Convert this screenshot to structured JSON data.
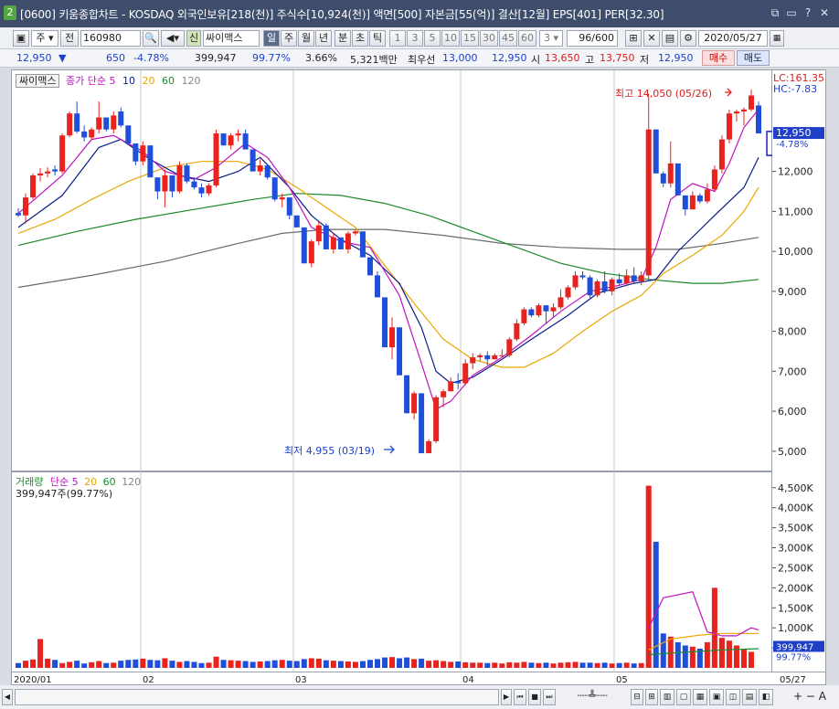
{
  "window": {
    "number": "2",
    "title": "[0600] 키움종합차트 - KOSDAQ 외국인보유[218(천)] 주식수[10,924(천)] 액면[500] 자본금[55(억)] 결산[12월] EPS[401] PER[32.30]",
    "buttons": [
      "⧉",
      "▭",
      "?",
      "✕"
    ]
  },
  "toolbar": {
    "period_select": "주",
    "prev_label": "전",
    "code": "160980",
    "new_badge": "신",
    "stock_name": "싸이맥스",
    "period_tabs": [
      "일",
      "주",
      "월",
      "년",
      "분",
      "초",
      "틱"
    ],
    "minute_options": [
      "1",
      "3",
      "5",
      "10",
      "15",
      "30",
      "45",
      "60"
    ],
    "minute_value": "3",
    "count": "96/600",
    "date": "2020/05/27"
  },
  "quote": {
    "price": "12,950",
    "change_arrow": "▼",
    "change": "650",
    "change_pct": "-4.78%",
    "volume": "399,947",
    "vol_ratio": "99.77%",
    "turnover": "3.66%",
    "amount": "5,321백만",
    "best_ask_label": "최우선",
    "best_ask": "13,000",
    "best_bid": "12,950",
    "open_label": "시",
    "open": "13,650",
    "high_label": "고",
    "high": "13,750",
    "low_label": "저",
    "low": "12,950",
    "buy_label": "매수",
    "sell_label": "매도"
  },
  "legend": {
    "name": "싸이맥스",
    "ma_label": "종가 단순",
    "ma_periods": [
      "5",
      "10",
      "20",
      "60",
      "120"
    ]
  },
  "vol_legend": {
    "name": "거래량",
    "ma_label": "단순",
    "ma_periods": [
      "5",
      "20",
      "60",
      "120"
    ],
    "current": "399,947주(99.77%)"
  },
  "annotations": {
    "high": "최고 14,050 (05/26)",
    "low": "최저 4,955 (03/19)",
    "lc": "LC:161.35",
    "hc": "HC:-7.83",
    "last_price": "12,950",
    "last_pct": "-4.78%",
    "last_vol": "399,947",
    "last_vol_pct": "99.77%"
  },
  "colors": {
    "up": "#e8231f",
    "down": "#1f4ed8",
    "ma5": "#c013c0",
    "ma10": "#0b1e8a",
    "ma20": "#e8a700",
    "ma60": "#1a8a2a",
    "ma120": "#6b6b6b"
  },
  "chart_data": {
    "type": "candlestick",
    "ylim": [
      4700,
      14300
    ],
    "y_ticks": [
      5000,
      6000,
      7000,
      8000,
      9000,
      10000,
      11000,
      12000
    ],
    "y_tick_labels": [
      "5,000",
      "6,000",
      "7,000",
      "8,000",
      "9,000",
      "10,000",
      "11,000",
      "12,000"
    ],
    "x_labels": [
      "2020/01",
      "02",
      "03",
      "04",
      "05",
      "05/27"
    ],
    "candles": [
      [
        10960,
        11080,
        10860,
        10900
      ],
      [
        10900,
        11450,
        10700,
        11350
      ],
      [
        11350,
        11950,
        11300,
        11900
      ],
      [
        11900,
        12080,
        11750,
        11950
      ],
      [
        11950,
        12100,
        11850,
        12000
      ],
      [
        12050,
        12150,
        11900,
        12000
      ],
      [
        12000,
        12950,
        11950,
        12900
      ],
      [
        12900,
        13500,
        12850,
        13450
      ],
      [
        13450,
        13750,
        12950,
        13000
      ],
      [
        13000,
        13150,
        12750,
        12850
      ],
      [
        12850,
        13100,
        12800,
        13050
      ],
      [
        13050,
        13750,
        12950,
        13350
      ],
      [
        13350,
        13350,
        13000,
        13050
      ],
      [
        13050,
        13500,
        12950,
        13400
      ],
      [
        13500,
        13600,
        13100,
        13150
      ],
      [
        13150,
        13150,
        12750,
        12700
      ],
      [
        12700,
        12700,
        12150,
        12250
      ],
      [
        12250,
        12750,
        12150,
        12650
      ],
      [
        12650,
        12650,
        11900,
        11850
      ],
      [
        11850,
        11850,
        11300,
        11500
      ],
      [
        11500,
        12050,
        11100,
        11900
      ],
      [
        11900,
        11900,
        11350,
        11500
      ],
      [
        11500,
        12250,
        11450,
        12150
      ],
      [
        12150,
        12200,
        11700,
        11750
      ],
      [
        11750,
        11850,
        11550,
        11600
      ],
      [
        11600,
        11700,
        11350,
        11450
      ],
      [
        11450,
        11700,
        11400,
        11650
      ],
      [
        11650,
        13050,
        11600,
        12950
      ],
      [
        12950,
        12950,
        12650,
        12650
      ],
      [
        12650,
        12950,
        12550,
        12900
      ],
      [
        12900,
        13050,
        12750,
        12950
      ],
      [
        12950,
        13050,
        12650,
        12550
      ],
      [
        12550,
        12550,
        12100,
        12000
      ],
      [
        12000,
        12300,
        11900,
        12150
      ],
      [
        12150,
        12150,
        11800,
        11850
      ],
      [
        11850,
        11850,
        11250,
        11300
      ],
      [
        11300,
        11450,
        11100,
        11350
      ],
      [
        11350,
        11350,
        10800,
        10900
      ],
      [
        10900,
        10900,
        10650,
        10600
      ],
      [
        10600,
        10600,
        9850,
        9700
      ],
      [
        9700,
        10300,
        9600,
        10250
      ],
      [
        10250,
        10750,
        10150,
        10650
      ],
      [
        10650,
        10700,
        10050,
        10050
      ],
      [
        10050,
        10450,
        9950,
        10350
      ],
      [
        10350,
        10350,
        10050,
        10050
      ],
      [
        10050,
        10500,
        9950,
        10450
      ],
      [
        10450,
        10550,
        10400,
        10500
      ],
      [
        10500,
        10500,
        9900,
        9850
      ],
      [
        9850,
        9850,
        9400,
        9400
      ],
      [
        9400,
        9500,
        8900,
        8850
      ],
      [
        8850,
        8850,
        7700,
        7600
      ],
      [
        7600,
        8350,
        7300,
        8100
      ],
      [
        8100,
        8100,
        7000,
        6900
      ],
      [
        6900,
        6900,
        5950,
        5950
      ],
      [
        5950,
        6500,
        5800,
        6450
      ],
      [
        6450,
        6450,
        5100,
        4950
      ],
      [
        4950,
        5300,
        4955,
        5250
      ],
      [
        5250,
        6400,
        5200,
        6350
      ],
      [
        6350,
        6550,
        6100,
        6500
      ],
      [
        6500,
        6850,
        6500,
        6750
      ],
      [
        6750,
        6950,
        6550,
        6700
      ],
      [
        6700,
        7300,
        6650,
        7200
      ],
      [
        7200,
        7450,
        7050,
        7350
      ],
      [
        7350,
        7450,
        7250,
        7400
      ],
      [
        7400,
        7500,
        7150,
        7300
      ],
      [
        7300,
        7450,
        7300,
        7400
      ],
      [
        7400,
        7550,
        7350,
        7400
      ],
      [
        7400,
        7850,
        7350,
        7800
      ],
      [
        7800,
        8300,
        7750,
        8200
      ],
      [
        8200,
        8600,
        8150,
        8550
      ],
      [
        8550,
        8600,
        8350,
        8400
      ],
      [
        8400,
        8700,
        8350,
        8650
      ],
      [
        8650,
        8650,
        8200,
        8500
      ],
      [
        8500,
        8700,
        8350,
        8600
      ],
      [
        8600,
        9050,
        8550,
        8850
      ],
      [
        8850,
        9150,
        8800,
        9100
      ],
      [
        9100,
        9500,
        9050,
        9400
      ],
      [
        9400,
        9500,
        9300,
        9350
      ],
      [
        9350,
        9400,
        8800,
        8900
      ],
      [
        8900,
        9300,
        8850,
        9250
      ],
      [
        9250,
        9500,
        8950,
        9000
      ],
      [
        9000,
        9350,
        8900,
        9300
      ],
      [
        9300,
        9450,
        9150,
        9200
      ],
      [
        9200,
        9550,
        9150,
        9400
      ],
      [
        9400,
        9600,
        9200,
        9250
      ],
      [
        9250,
        9500,
        9150,
        9400
      ],
      [
        9400,
        13950,
        9300,
        13050
      ],
      [
        13050,
        13050,
        12100,
        11950
      ],
      [
        11950,
        12000,
        11600,
        11700
      ],
      [
        11700,
        12750,
        11600,
        12200
      ],
      [
        12200,
        12200,
        11550,
        11400
      ],
      [
        11400,
        11400,
        10900,
        11050
      ],
      [
        11050,
        11500,
        11050,
        11400
      ],
      [
        11400,
        11450,
        11200,
        11250
      ],
      [
        11250,
        11700,
        11200,
        11550
      ],
      [
        11550,
        12150,
        11500,
        12050
      ],
      [
        12050,
        12900,
        11950,
        12800
      ],
      [
        12800,
        13550,
        12700,
        13450
      ],
      [
        13450,
        13550,
        13250,
        13500
      ],
      [
        13500,
        13600,
        13150,
        13550
      ],
      [
        13550,
        14050,
        13500,
        13900
      ],
      [
        13650,
        13750,
        12950,
        12950
      ]
    ],
    "ma": {
      "ma5": [
        [
          0,
          10950
        ],
        [
          6,
          11900
        ],
        [
          10,
          12800
        ],
        [
          13,
          12900
        ],
        [
          17,
          12500
        ],
        [
          20,
          12000
        ],
        [
          24,
          11800
        ],
        [
          27,
          12100
        ],
        [
          31,
          12700
        ],
        [
          34,
          12350
        ],
        [
          37,
          11600
        ],
        [
          40,
          10600
        ],
        [
          44,
          10250
        ],
        [
          48,
          10100
        ],
        [
          52,
          8900
        ],
        [
          55,
          7200
        ],
        [
          57,
          6050
        ],
        [
          59,
          6250
        ],
        [
          62,
          6900
        ],
        [
          66,
          7350
        ],
        [
          70,
          7900
        ],
        [
          74,
          8500
        ],
        [
          78,
          9000
        ],
        [
          82,
          9150
        ],
        [
          85,
          9300
        ],
        [
          87,
          10100
        ],
        [
          89,
          11300
        ],
        [
          92,
          11700
        ],
        [
          95,
          11500
        ],
        [
          97,
          12200
        ],
        [
          99,
          13100
        ],
        [
          101,
          13550
        ]
      ],
      "ma10": [
        [
          0,
          10600
        ],
        [
          6,
          11400
        ],
        [
          11,
          12600
        ],
        [
          14,
          12800
        ],
        [
          18,
          12300
        ],
        [
          22,
          11900
        ],
        [
          26,
          11750
        ],
        [
          30,
          12000
        ],
        [
          33,
          12350
        ],
        [
          37,
          11600
        ],
        [
          40,
          10900
        ],
        [
          44,
          10300
        ],
        [
          48,
          9900
        ],
        [
          52,
          9200
        ],
        [
          55,
          8100
        ],
        [
          57,
          7000
        ],
        [
          59,
          6700
        ],
        [
          62,
          6850
        ],
        [
          66,
          7300
        ],
        [
          70,
          7800
        ],
        [
          75,
          8400
        ],
        [
          79,
          8950
        ],
        [
          84,
          9200
        ],
        [
          87,
          9300
        ],
        [
          90,
          10000
        ],
        [
          95,
          10900
        ],
        [
          99,
          11600
        ],
        [
          101,
          12350
        ]
      ],
      "ma20": [
        [
          0,
          10450
        ],
        [
          5,
          10800
        ],
        [
          10,
          11300
        ],
        [
          15,
          11750
        ],
        [
          20,
          12100
        ],
        [
          25,
          12250
        ],
        [
          30,
          12250
        ],
        [
          34,
          12050
        ],
        [
          38,
          11600
        ],
        [
          42,
          11100
        ],
        [
          46,
          10600
        ],
        [
          50,
          9650
        ],
        [
          54,
          8700
        ],
        [
          58,
          7800
        ],
        [
          62,
          7300
        ],
        [
          66,
          7100
        ],
        [
          69,
          7100
        ],
        [
          73,
          7450
        ],
        [
          77,
          8000
        ],
        [
          81,
          8500
        ],
        [
          85,
          8900
        ],
        [
          88,
          9450
        ],
        [
          92,
          9900
        ],
        [
          96,
          10400
        ],
        [
          99,
          11000
        ],
        [
          101,
          11600
        ]
      ],
      "ma60": [
        [
          0,
          10150
        ],
        [
          8,
          10500
        ],
        [
          16,
          10800
        ],
        [
          24,
          11050
        ],
        [
          32,
          11300
        ],
        [
          38,
          11450
        ],
        [
          44,
          11400
        ],
        [
          50,
          11200
        ],
        [
          56,
          10900
        ],
        [
          62,
          10500
        ],
        [
          68,
          10100
        ],
        [
          74,
          9700
        ],
        [
          80,
          9450
        ],
        [
          86,
          9300
        ],
        [
          92,
          9200
        ],
        [
          96,
          9200
        ],
        [
          101,
          9300
        ]
      ],
      "ma120": [
        [
          0,
          9100
        ],
        [
          10,
          9400
        ],
        [
          20,
          9750
        ],
        [
          30,
          10200
        ],
        [
          36,
          10450
        ],
        [
          42,
          10550
        ],
        [
          50,
          10550
        ],
        [
          58,
          10400
        ],
        [
          66,
          10200
        ],
        [
          74,
          10100
        ],
        [
          82,
          10050
        ],
        [
          90,
          10050
        ],
        [
          96,
          10200
        ],
        [
          101,
          10350
        ]
      ]
    },
    "volume": {
      "ylim": [
        0,
        4700
      ],
      "y_ticks": [
        500,
        1000,
        1500,
        2000,
        2500,
        3000,
        3500,
        4000,
        4500
      ],
      "y_tick_labels": [
        "500K",
        "1,000K",
        "1,500K",
        "2,000K",
        "2,500K",
        "3,000K",
        "3,500K",
        "4,000K",
        "4,500K"
      ],
      "values": [
        120,
        180,
        210,
        720,
        230,
        200,
        120,
        150,
        180,
        110,
        140,
        170,
        120,
        130,
        180,
        200,
        210,
        230,
        200,
        190,
        240,
        180,
        150,
        170,
        150,
        120,
        130,
        280,
        200,
        190,
        180,
        170,
        150,
        160,
        170,
        190,
        200,
        180,
        170,
        220,
        240,
        230,
        190,
        180,
        170,
        160,
        150,
        170,
        200,
        220,
        260,
        270,
        240,
        260,
        220,
        230,
        180,
        190,
        170,
        150,
        160,
        140,
        130,
        130,
        120,
        130,
        110,
        140,
        130,
        150,
        130,
        120,
        130,
        110,
        130,
        140,
        150,
        130,
        130,
        120,
        130,
        110,
        120,
        130,
        110,
        120,
        4550,
        3150,
        860,
        780,
        640,
        560,
        530,
        480,
        640,
        2000,
        750,
        680,
        560,
        460,
        400
      ],
      "ma5": [
        [
          86,
          1000
        ],
        [
          88,
          1750
        ],
        [
          92,
          1900
        ],
        [
          94,
          900
        ],
        [
          96,
          800
        ],
        [
          98,
          800
        ],
        [
          100,
          1000
        ],
        [
          101,
          950
        ]
      ],
      "ma20": [
        [
          86,
          450
        ],
        [
          89,
          720
        ],
        [
          93,
          820
        ],
        [
          96,
          860
        ],
        [
          101,
          860
        ]
      ],
      "ma60": [
        [
          86,
          330
        ],
        [
          90,
          380
        ],
        [
          96,
          450
        ],
        [
          101,
          480
        ]
      ]
    }
  }
}
